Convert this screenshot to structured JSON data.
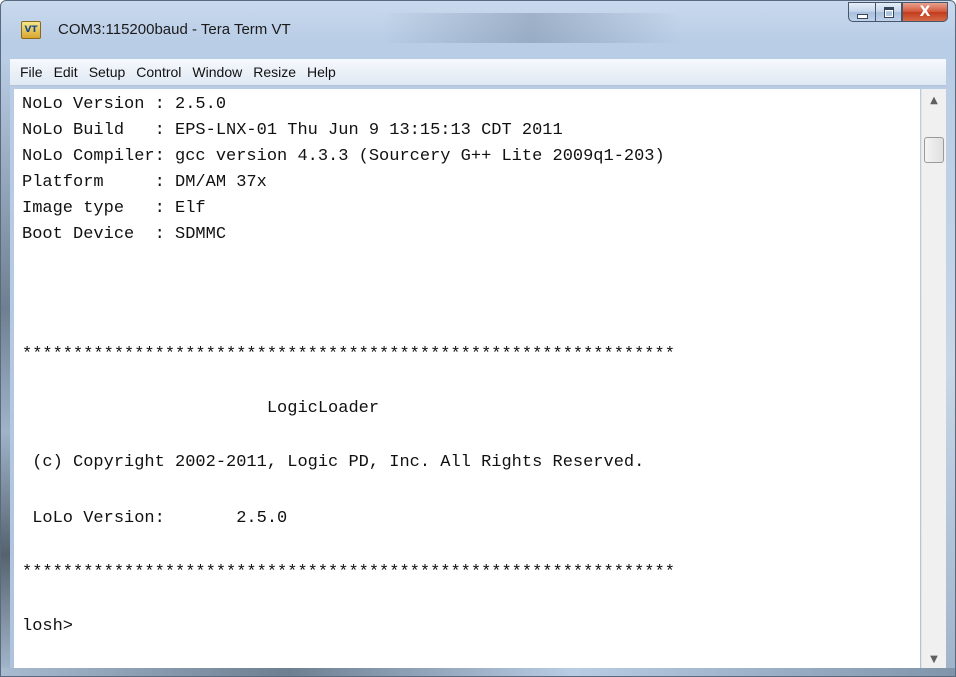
{
  "window": {
    "title": "COM3:115200baud - Tera Term VT",
    "app_icon_label": "VT",
    "minimize_icon": "minimize-icon",
    "maximize_icon": "maximize-icon",
    "close_icon": "close-icon",
    "close_glyph": "X"
  },
  "menu": {
    "items": [
      "File",
      "Edit",
      "Setup",
      "Control",
      "Window",
      "Resize",
      "Help"
    ]
  },
  "terminal": {
    "lines": [
      "NoLo Version : 2.5.0",
      "NoLo Build   : EPS-LNX-01 Thu Jun 9 13:15:13 CDT 2011",
      "NoLo Compiler: gcc version 4.3.3 (Sourcery G++ Lite 2009q1-203)",
      "Platform     : DM/AM 37x",
      "Image type   : Elf",
      "Boot Device  : SDMMC",
      "****************************************************************",
      "                        LogicLoader",
      " (c) Copyright 2002-2011, Logic PD, Inc. All Rights Reserved.",
      " LoLo Version:       2.5.0",
      "****************************************************************",
      "losh>"
    ]
  },
  "scrollbar": {
    "up_arrow": "▲",
    "down_arrow": "▼"
  }
}
